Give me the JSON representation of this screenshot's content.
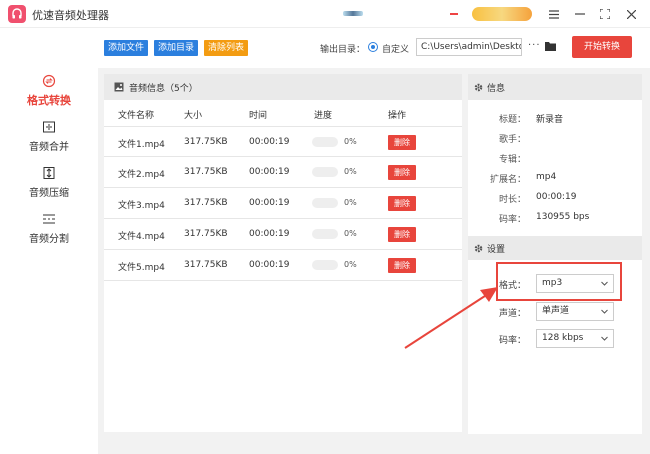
{
  "app": {
    "title": "优速音频处理器"
  },
  "colors": {
    "accent": "#e8453c",
    "primary": "#2b7fde",
    "warning": "#f39c12"
  },
  "nav": {
    "items": [
      {
        "label": "格式转换",
        "active": true,
        "icon": "format-convert-icon"
      },
      {
        "label": "音频合并",
        "active": false,
        "icon": "merge-icon"
      },
      {
        "label": "音频压缩",
        "active": false,
        "icon": "compress-icon"
      },
      {
        "label": "音频分割",
        "active": false,
        "icon": "split-icon"
      }
    ]
  },
  "toolbar": {
    "add_file": "添加文件",
    "add_folder": "添加目录",
    "clear_list": "清除列表",
    "output_label": "输出目录：",
    "custom_label": "自定义",
    "output_path": "C:\\Users\\admin\\Deskto",
    "more": "···",
    "start": "开始转换"
  },
  "files": {
    "header": "音频信息（5个）",
    "columns": [
      "文件名称",
      "大小",
      "时间",
      "进度",
      "操作"
    ],
    "rows": [
      {
        "name": "文件1.mp4",
        "size": "317.75KB",
        "time": "00:00:19",
        "progress": 0,
        "pct": "0%",
        "action": "删除"
      },
      {
        "name": "文件2.mp4",
        "size": "317.75KB",
        "time": "00:00:19",
        "progress": 0,
        "pct": "0%",
        "action": "删除"
      },
      {
        "name": "文件3.mp4",
        "size": "317.75KB",
        "time": "00:00:19",
        "progress": 0,
        "pct": "0%",
        "action": "删除"
      },
      {
        "name": "文件4.mp4",
        "size": "317.75KB",
        "time": "00:00:19",
        "progress": 0,
        "pct": "0%",
        "action": "删除"
      },
      {
        "name": "文件5.mp4",
        "size": "317.75KB",
        "time": "00:00:19",
        "progress": 0,
        "pct": "0%",
        "action": "删除"
      }
    ]
  },
  "info": {
    "header": "信息",
    "fields": [
      {
        "label": "标题：",
        "value": "新录音"
      },
      {
        "label": "歌手：",
        "value": ""
      },
      {
        "label": "专辑：",
        "value": ""
      },
      {
        "label": "扩展名：",
        "value": "mp4"
      },
      {
        "label": "时长：",
        "value": "00:00:19"
      },
      {
        "label": "码率：",
        "value": "130955 bps"
      }
    ]
  },
  "settings": {
    "header": "设置",
    "format_label": "格式：",
    "format_value": "mp3",
    "channel_label": "声道：",
    "channel_value": "单声道",
    "bitrate_label": "码率：",
    "bitrate_value": "128 kbps"
  }
}
